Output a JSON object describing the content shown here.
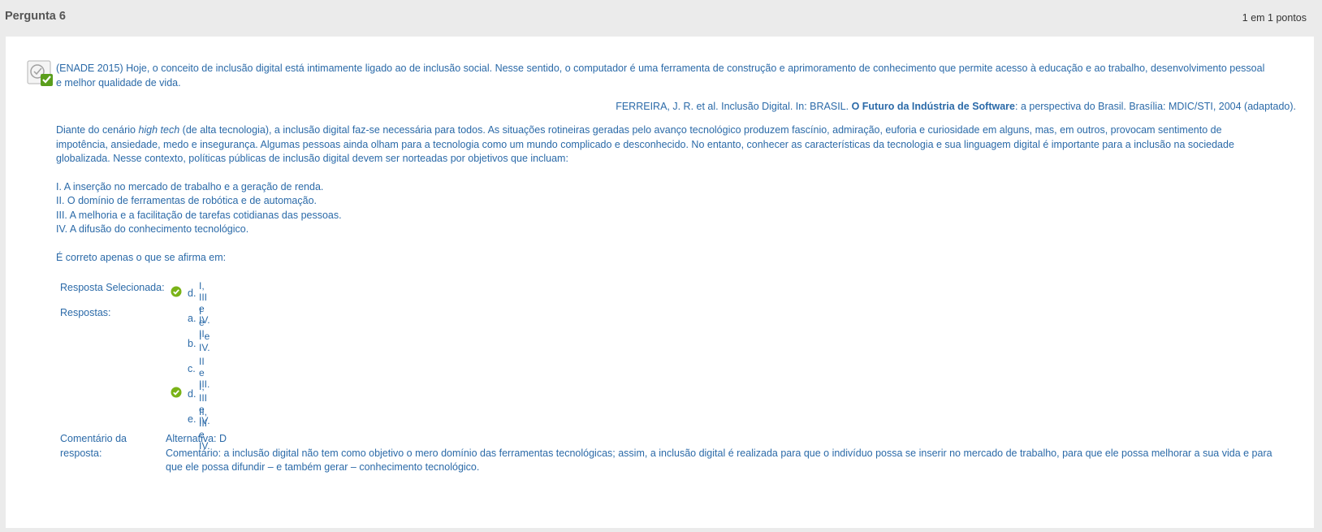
{
  "question": {
    "title": "Pergunta 6",
    "points": "1 em 1 pontos",
    "status_icon": "correct-answer-icon",
    "intro": "(ENADE 2015) Hoje, o conceito de inclusão digital está intimamente ligado ao de inclusão social. Nesse sentido, o computador é uma ferramenta de construção e aprimoramento de conhecimento que permite acesso à educação e ao trabalho, desenvolvimento pessoal e melhor qualidade de vida.",
    "citation": {
      "prefix": "FERREIRA, J. R. et al. Inclusão Digital. In: BRASIL. ",
      "bold": "O Futuro da Indústria de Software",
      "suffix": ": a perspectiva do Brasil. Brasília: MDIC/STI, 2004 (adaptado)."
    },
    "paragraph": {
      "pre": "Diante do cenário ",
      "italic": "high tech",
      "post": " (de alta tecnologia), a inclusão digital faz-se necessária para todos. As situações rotineiras geradas pelo avanço tecnológico produzem fascínio, admiração, euforia e curiosidade em alguns, mas, em outros, provocam sentimento de impotência, ansiedade, medo e insegurança. Algumas pessoas ainda olham para a tecnologia como um mundo complicado e desconhecido. No entanto, conhecer as características da tecnologia e sua linguagem digital é importante para a inclusão na sociedade globalizada. Nesse contexto, políticas públicas de inclusão digital devem ser norteadas por objetivos que incluam:"
    },
    "items": [
      "I. A inserção no mercado de trabalho e a geração de renda.",
      "II. O domínio de ferramentas de robótica e de automação.",
      "III. A melhoria e a facilitação de tarefas cotidianas das pessoas.",
      "IV. A difusão do conhecimento tecnológico."
    ],
    "prompt": "É correto apenas o que se afirma em:"
  },
  "answers": {
    "selected_label": "Resposta Selecionada:",
    "selected": {
      "letter": "d.",
      "text": "I, III e IV."
    },
    "options_label": "Respostas:",
    "options": [
      {
        "letter": "a.",
        "text": "I e II."
      },
      {
        "letter": "b.",
        "text": "I e IV."
      },
      {
        "letter": "c.",
        "text": "II e III."
      },
      {
        "letter": "d.",
        "text": "I, III e IV."
      },
      {
        "letter": "e.",
        "text": "II, III e IV."
      }
    ],
    "correct_index": 3,
    "check_color": "#7ab317"
  },
  "feedback": {
    "label_line1": "Comentário da",
    "label_line2": "resposta:",
    "alternative": "Alternativa: D",
    "comment": "Comentário: a inclusão digital não tem como objetivo o mero domínio das ferramentas tecnológicas; assim, a inclusão digital é realizada para que o indivíduo possa se inserir no mercado de trabalho, para que ele possa melhorar a sua vida e para que ele possa difundir – e também gerar – conhecimento tecnológico."
  }
}
